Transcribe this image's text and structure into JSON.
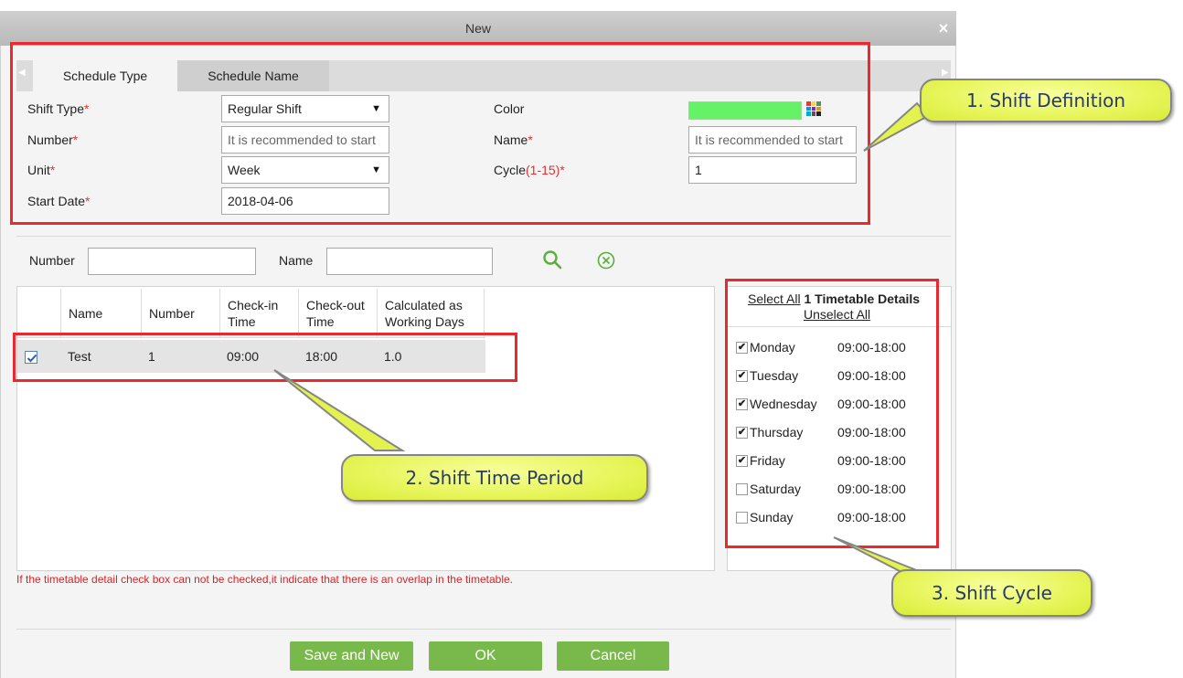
{
  "dialog": {
    "title": "New",
    "close_label": "×"
  },
  "tabs": [
    {
      "label": "Schedule Type",
      "active": true
    },
    {
      "label": "Schedule Name",
      "active": false
    }
  ],
  "form": {
    "shift_type": {
      "label": "Shift Type",
      "required": "*",
      "value": "Regular Shift"
    },
    "number": {
      "label": "Number",
      "required": "*",
      "placeholder": "It is recommended to start"
    },
    "unit": {
      "label": "Unit",
      "required": "*",
      "value": "Week"
    },
    "start_date": {
      "label": "Start Date",
      "required": "*",
      "value": "2018-04-06"
    },
    "color": {
      "label": "Color",
      "value": "#66f266"
    },
    "name": {
      "label": "Name",
      "required": "*",
      "placeholder": "It is recommended to start"
    },
    "cycle": {
      "label": "Cycle",
      "range": "(1-15)",
      "required": "*",
      "value": "1"
    }
  },
  "filter": {
    "number_label": "Number",
    "name_label": "Name",
    "search_icon": "search-icon",
    "clear_icon": "clear-circle-icon"
  },
  "table": {
    "columns": [
      "Name",
      "Number",
      "Check-in Time",
      "Check-out Time",
      "Calculated as Working Days"
    ],
    "rows": [
      {
        "checked": true,
        "name": "Test",
        "number": "1",
        "check_in": "09:00",
        "check_out": "18:00",
        "working_days": "1.0"
      }
    ]
  },
  "hint": "If the timetable detail check box can not be checked,it indicate that there is an overlap in the timetable.",
  "timetable": {
    "select_all": "Select All",
    "count": "1",
    "title_suffix": "Timetable Details",
    "unselect_all": "Unselect All",
    "days": [
      {
        "day": "Monday",
        "checked": true,
        "time": "09:00-18:00"
      },
      {
        "day": "Tuesday",
        "checked": true,
        "time": "09:00-18:00"
      },
      {
        "day": "Wednesday",
        "checked": true,
        "time": "09:00-18:00"
      },
      {
        "day": "Thursday",
        "checked": true,
        "time": "09:00-18:00"
      },
      {
        "day": "Friday",
        "checked": true,
        "time": "09:00-18:00"
      },
      {
        "day": "Saturday",
        "checked": false,
        "time": "09:00-18:00"
      },
      {
        "day": "Sunday",
        "checked": false,
        "time": "09:00-18:00"
      }
    ]
  },
  "buttons": {
    "save_new": "Save and New",
    "ok": "OK",
    "cancel": "Cancel"
  },
  "callouts": {
    "shift_definition": "1. Shift Definition",
    "shift_time_period": "2. Shift Time Period",
    "shift_cycle": "3. Shift Cycle"
  },
  "colors": {
    "accent_green": "#79b94c",
    "highlight_red": "#e8292d",
    "callout_yellow": "#e7f55a"
  }
}
